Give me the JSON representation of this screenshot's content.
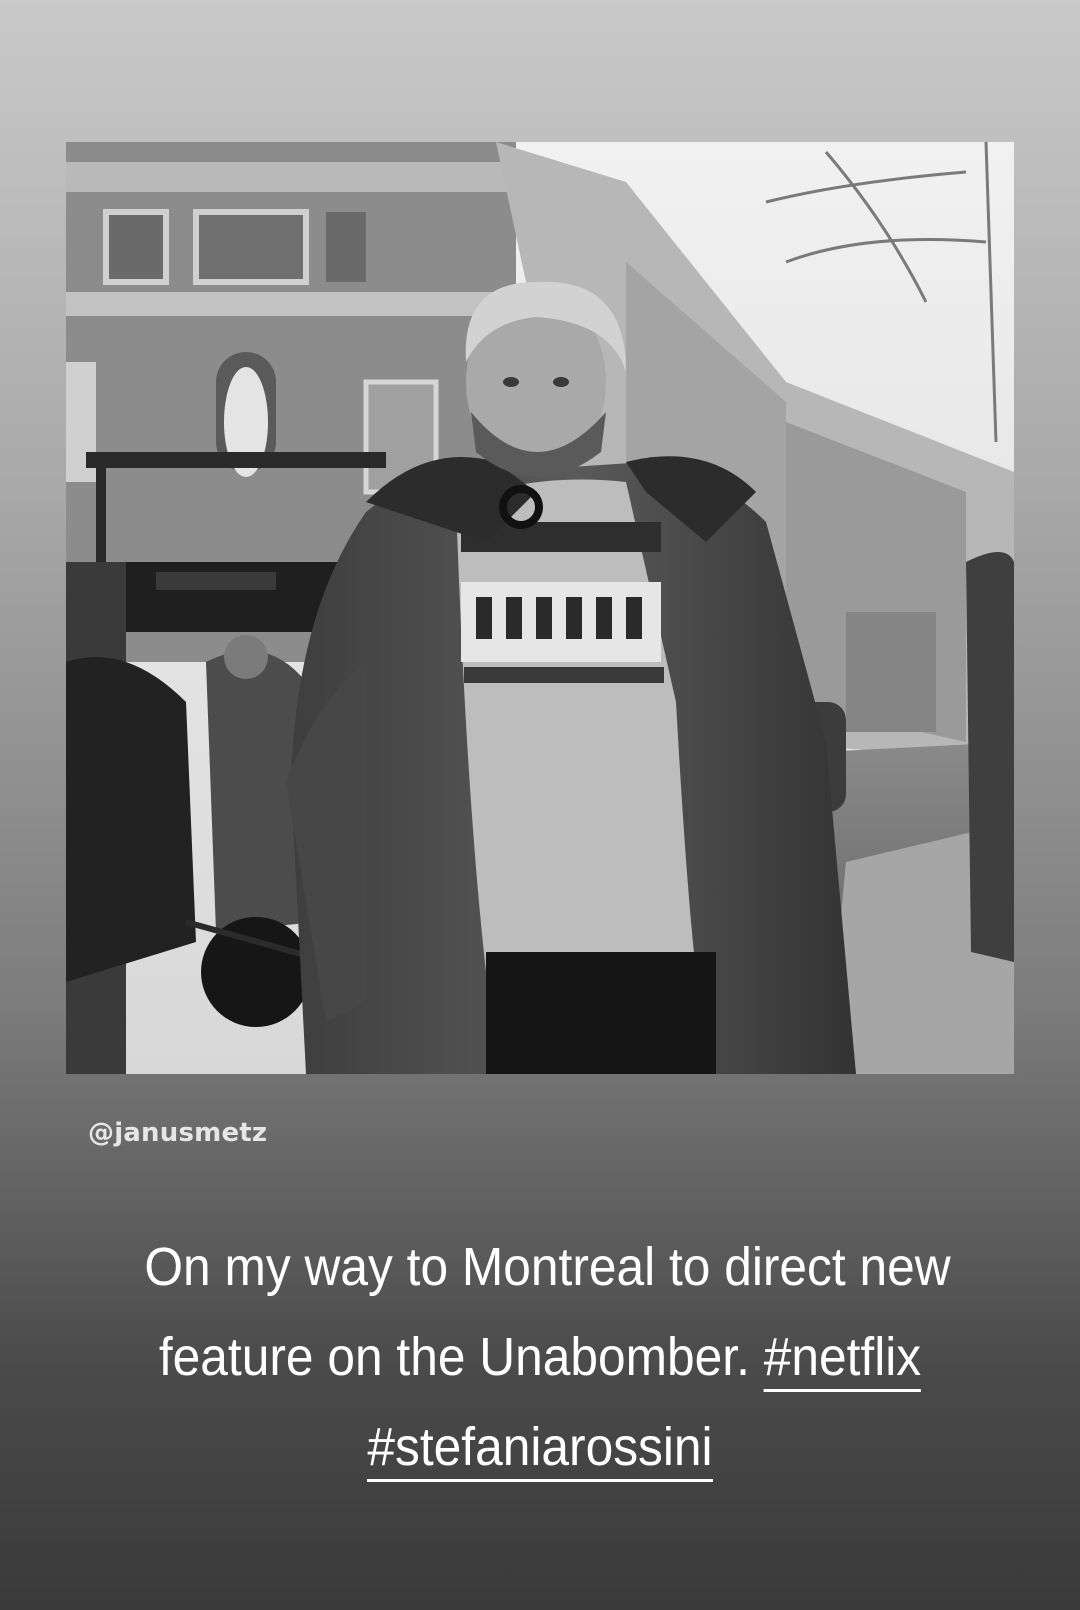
{
  "story": {
    "mention": "@janusmetz",
    "caption": {
      "line1": "On my way to Montreal to direct new",
      "line2_text": "feature on the Unabomber.",
      "hashtag1": "#netflix",
      "hashtag2": "#stefaniarossini"
    },
    "colors": {
      "background_top": "#c9c9c9",
      "background_bottom": "#3a3a3a",
      "text": "#ffffff"
    }
  }
}
